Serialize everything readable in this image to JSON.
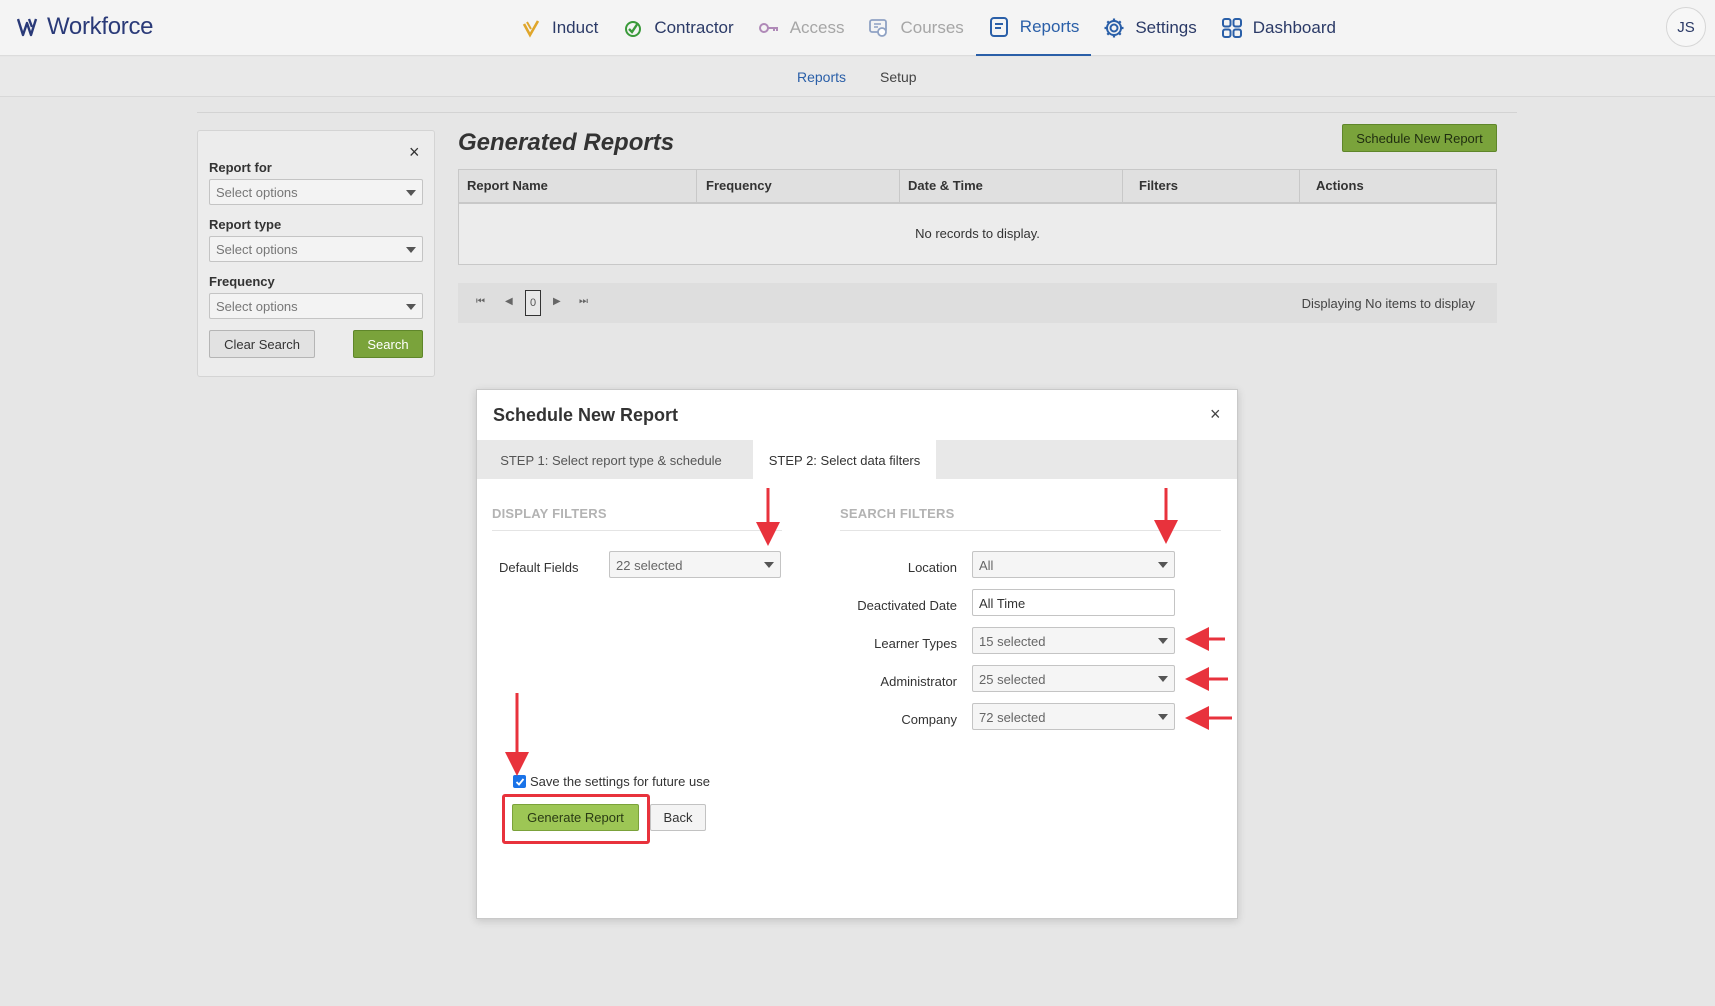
{
  "brand": {
    "name": "Workforce",
    "logo_color": "#2a3a78"
  },
  "nav": {
    "items": [
      {
        "label": "Induct",
        "icon": "induct-icon",
        "state": "normal"
      },
      {
        "label": "Contractor",
        "icon": "contractor-icon",
        "state": "normal"
      },
      {
        "label": "Access",
        "icon": "access-key-icon",
        "state": "disabled"
      },
      {
        "label": "Courses",
        "icon": "courses-icon",
        "state": "disabled"
      },
      {
        "label": "Reports",
        "icon": "reports-icon",
        "state": "active"
      },
      {
        "label": "Settings",
        "icon": "gear-icon",
        "state": "normal"
      },
      {
        "label": "Dashboard",
        "icon": "dashboard-grid-icon",
        "state": "normal"
      }
    ],
    "avatar_initials": "JS"
  },
  "subnav": {
    "reports": "Reports",
    "setup": "Setup"
  },
  "filter_panel": {
    "report_for_label": "Report for",
    "report_for_placeholder": "Select options",
    "report_type_label": "Report type",
    "report_type_placeholder": "Select options",
    "frequency_label": "Frequency",
    "frequency_placeholder": "Select options",
    "clear_label": "Clear Search",
    "search_label": "Search",
    "close_glyph": "×"
  },
  "reports": {
    "title": "Generated Reports",
    "schedule_button": "Schedule New Report",
    "columns": [
      "Report Name",
      "Frequency",
      "Date & Time",
      "Filters",
      "Actions"
    ],
    "empty_text": "No records to display.",
    "pager": {
      "page": "0",
      "status": "Displaying No items to display"
    }
  },
  "modal": {
    "title": "Schedule New Report",
    "close_glyph": "×",
    "tabs": {
      "step1": "STEP 1: Select report type & schedule",
      "step2": "STEP 2: Select data filters"
    },
    "display_filters": {
      "heading": "DISPLAY FILTERS",
      "default_fields_label": "Default Fields",
      "default_fields_value": "22 selected"
    },
    "search_filters": {
      "heading": "SEARCH FILTERS",
      "location_label": "Location",
      "location_value": "All",
      "deactivated_label": "Deactivated Date",
      "deactivated_value": "All Time",
      "learner_types_label": "Learner Types",
      "learner_types_value": "15 selected",
      "administrator_label": "Administrator",
      "administrator_value": "25 selected",
      "company_label": "Company",
      "company_value": "72 selected"
    },
    "save_settings": {
      "label": "Save the settings for future use",
      "checked": true
    },
    "generate_button": "Generate Report",
    "back_button": "Back"
  },
  "colors": {
    "accent_blue": "#2a5fa8",
    "button_green": "#7aa33b",
    "generate_green": "#9dc655",
    "annotation_red": "#e8323c"
  }
}
